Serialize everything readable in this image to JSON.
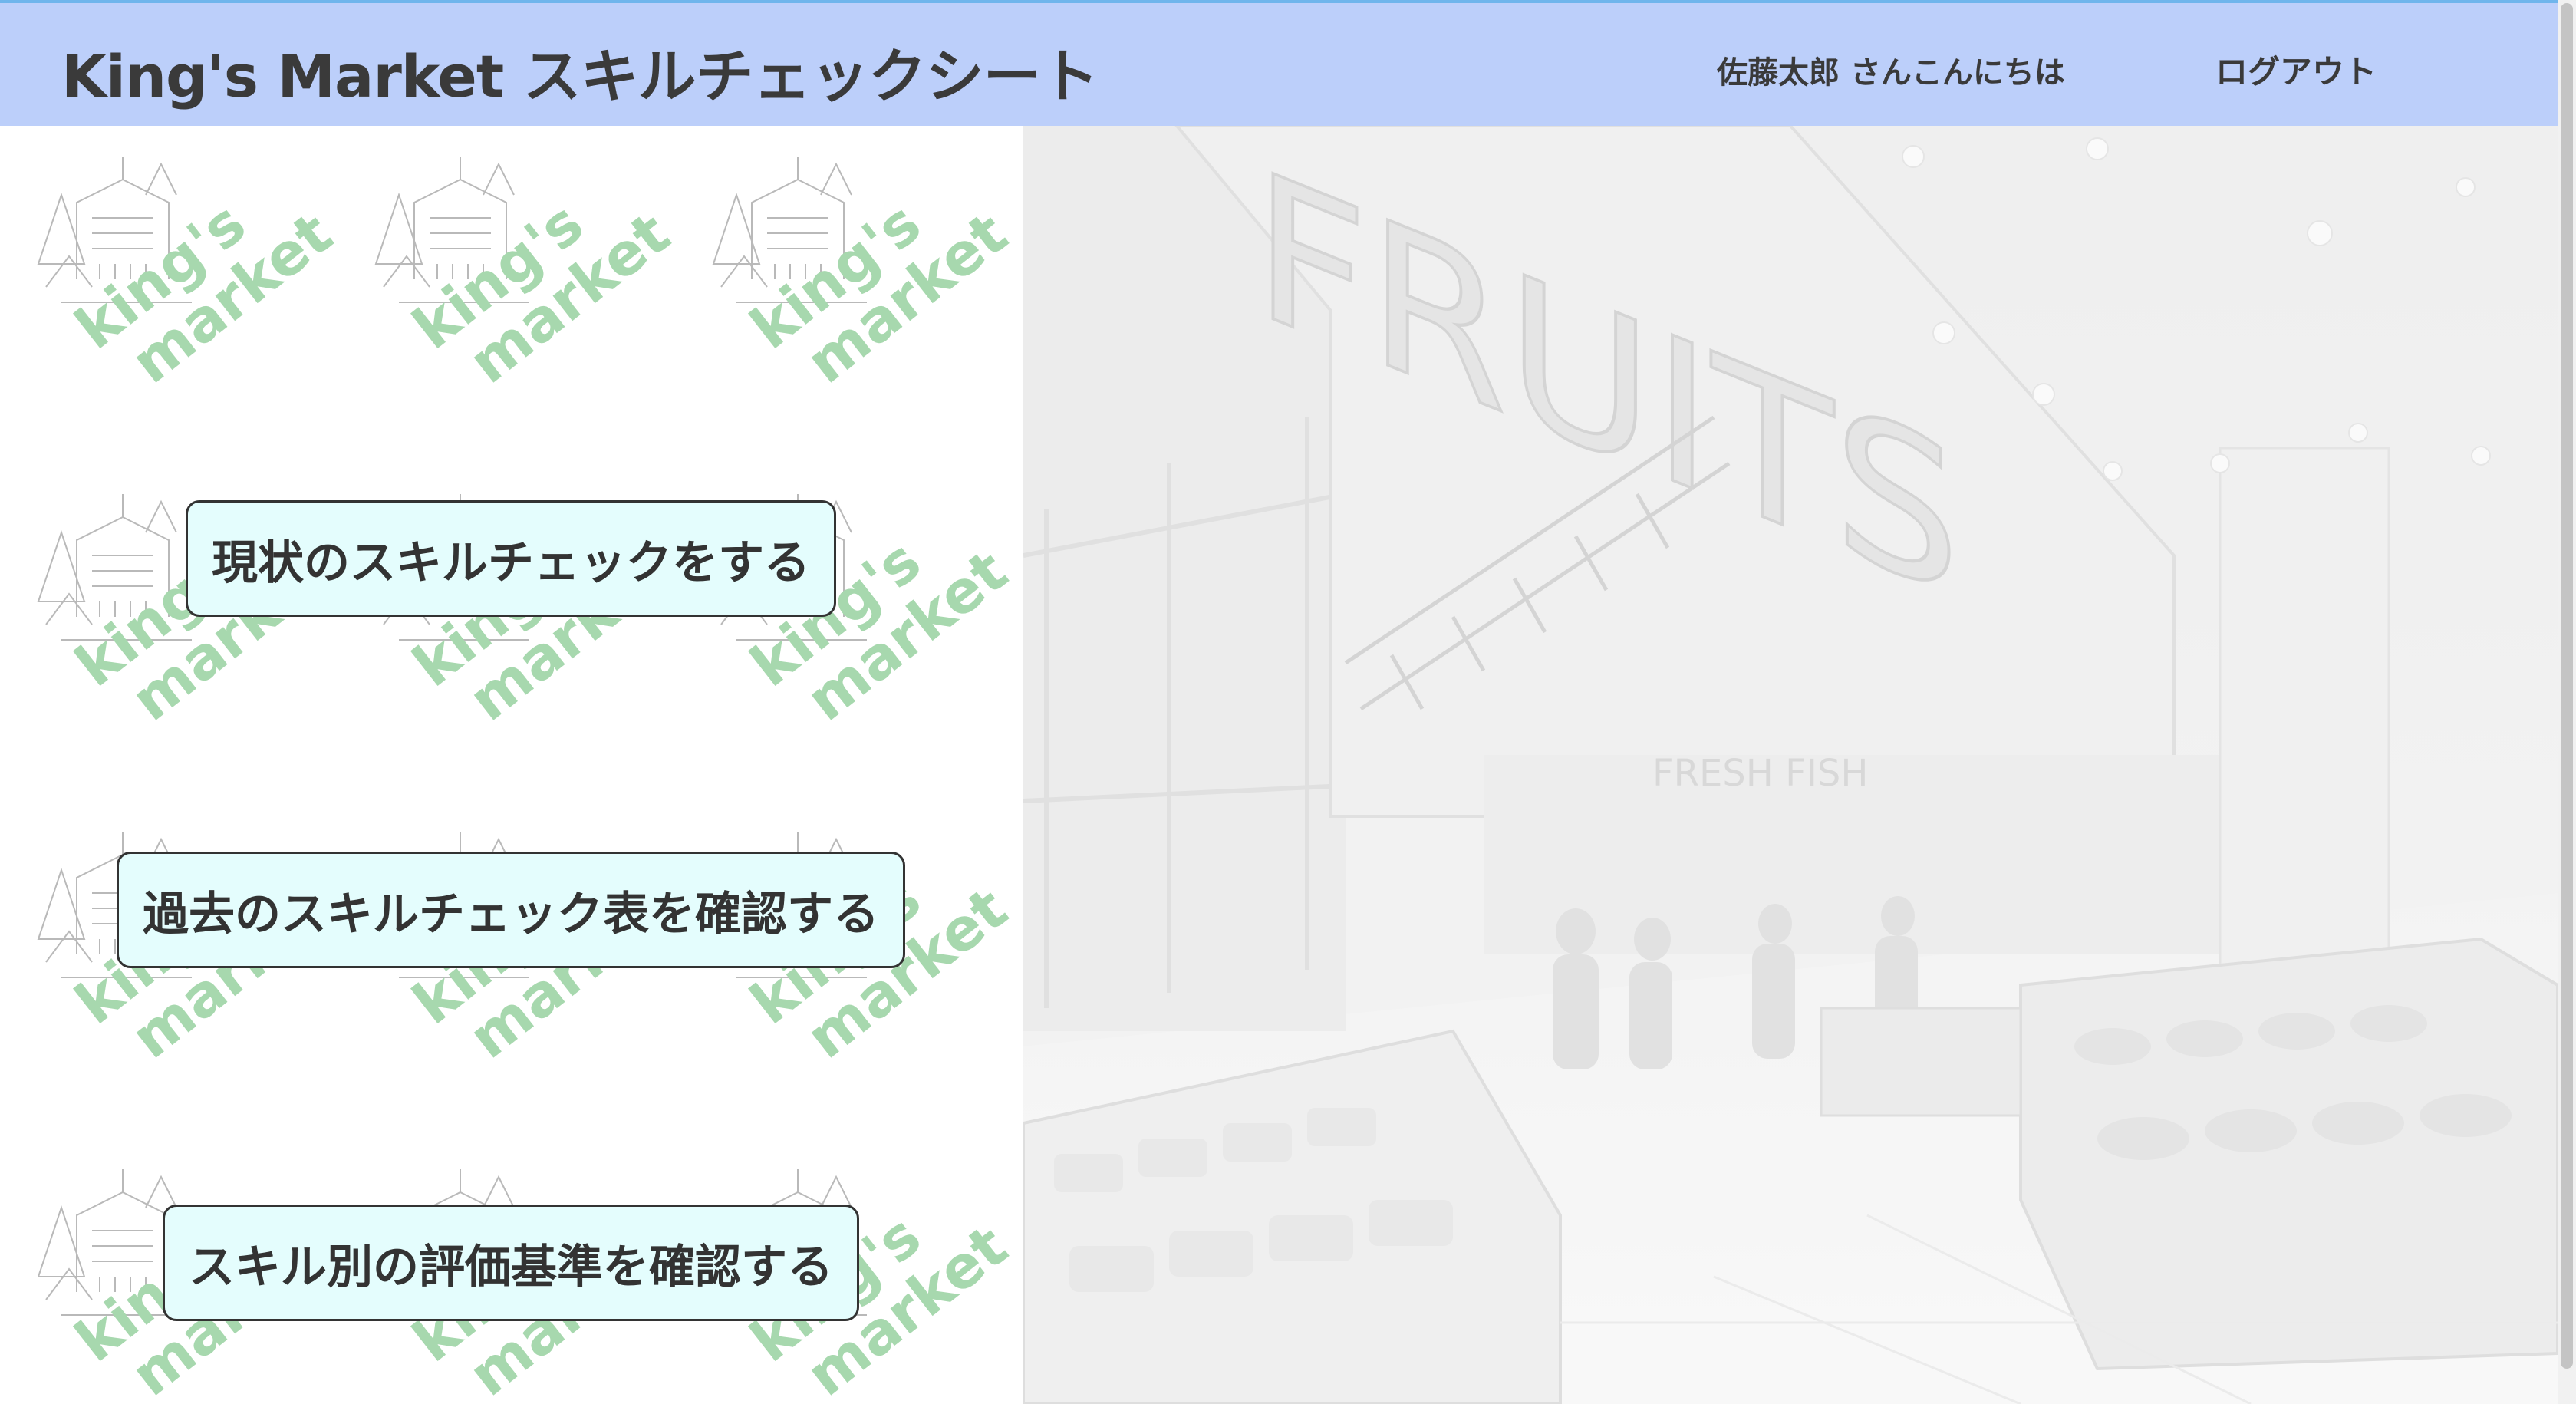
{
  "header": {
    "title": "King's Market スキルチェックシート",
    "greeting": "佐藤太郎 さんこんにちは",
    "logout_label": "ログアウト"
  },
  "actions": [
    {
      "label": "現状のスキルチェックをする"
    },
    {
      "label": "過去のスキルチェック表を確認する"
    },
    {
      "label": "スキル別の評価基準を確認する"
    }
  ],
  "background": {
    "watermark_text_line1": "king's",
    "watermark_text_line2": "market",
    "store_sign": "FRUITS",
    "store_sign_fresh": "FRESH FISH"
  },
  "colors": {
    "header_bg": "#bccffa",
    "button_bg": "#e4fdfd",
    "watermark_green": "#8fd09a"
  }
}
